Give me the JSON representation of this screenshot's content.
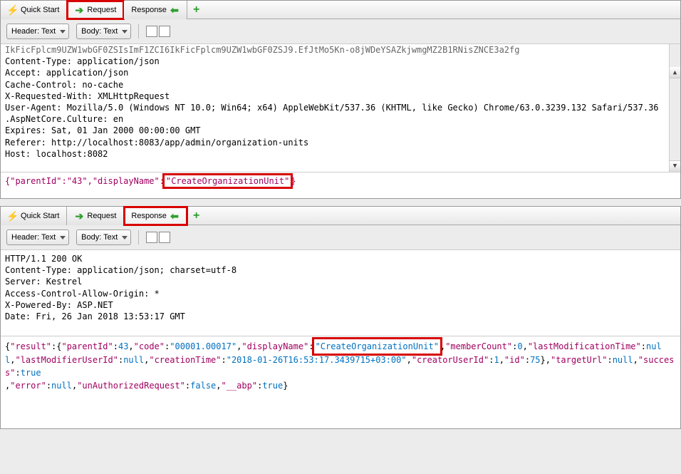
{
  "top": {
    "tabs": {
      "quickstart": "Quick Start",
      "request": "Request",
      "response": "Response"
    },
    "plus": "+",
    "toolbar": {
      "header_dd": "Header: Text",
      "body_dd": "Body: Text"
    },
    "req_headers_cut": "IkFicFplcm9UZW1wbGF0ZSIsImF1ZCI6IkFicFplcm9UZW1wbGF0ZSJ9.EfJtMo5Kn-o8jWDeYSAZkjwmgMZ2B1RNisZNCE3a2fg",
    "req_headers_top": "...",
    "req_headers": "Content-Type: application/json\nAccept: application/json\nCache-Control: no-cache\nX-Requested-With: XMLHttpRequest\nUser-Agent: Mozilla/5.0 (Windows NT 10.0; Win64; x64) AppleWebKit/537.36 (KHTML, like Gecko) Chrome/63.0.3239.132 Safari/537.36\n.AspNetCore.Culture: en\nExpires: Sat, 01 Jan 2000 00:00:00 GMT\nReferer: http://localhost:8083/app/admin/organization-units\nHost: localhost:8082",
    "req_body": {
      "p1": "{\"parentId\":\"43\",\"displayName\":",
      "hl": "\"CreateOrganizationUnit\"",
      "p2": "}"
    }
  },
  "bottom": {
    "tabs": {
      "quickstart": "Quick Start",
      "request": "Request",
      "response": "Response"
    },
    "toolbar": {
      "header_dd": "Header: Text",
      "body_dd": "Body: Text"
    },
    "resp_headers": "HTTP/1.1 200 OK\nContent-Type: application/json; charset=utf-8\nServer: Kestrel\nAccess-Control-Allow-Origin: *\nX-Powered-By: ASP.NET\nDate: Fri, 26 Jan 2018 13:53:17 GMT",
    "resp_body": {
      "result": {
        "parentId": 43,
        "code": "00001.00017",
        "displayName": "CreateOrganizationUnit",
        "memberCount": 0,
        "lastModificationTime": null,
        "lastModifierUserId": null,
        "creationTime": "2018-01-26T16:53:17.3439715+03:00",
        "creatorUserId": 1,
        "id": 75
      },
      "targetUrl": null,
      "success": true,
      "error": null,
      "unAuthorizedRequest": false,
      "__abp": true
    }
  }
}
